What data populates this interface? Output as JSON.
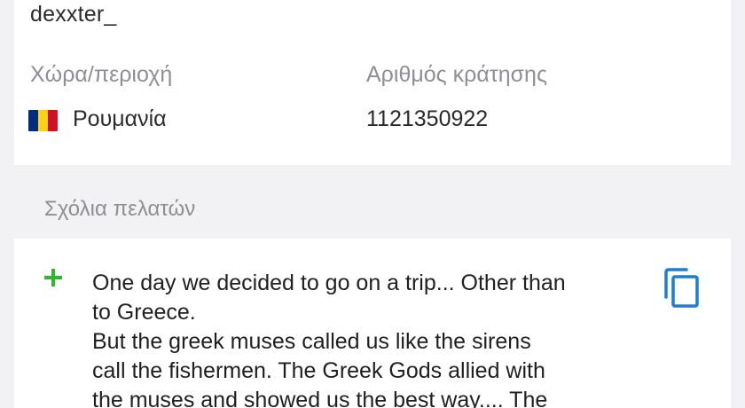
{
  "reviewer": {
    "username": "dexxter_"
  },
  "details": {
    "country_label": "Χώρα/περιοχή",
    "country_value": "Ρουμανία",
    "booking_label": "Αριθμός κράτησης",
    "booking_value": "1121350922",
    "flag_colors": [
      "#002b7f",
      "#fcd116",
      "#ce1126"
    ]
  },
  "comments": {
    "title": "Σχόλια πελατών",
    "lines": [
      "One day we decided to go on a trip... Other than",
      "to Greece.",
      "But the greek muses called us like the sirens",
      "call the fishermen. The Greek Gods allied with",
      "the muses and showed us the best way.... The"
    ],
    "plus_icon": "plus-icon",
    "copy_icon": "copy-icon",
    "accent_color": "#1a7fd4",
    "positive_color": "#2eb82e"
  }
}
